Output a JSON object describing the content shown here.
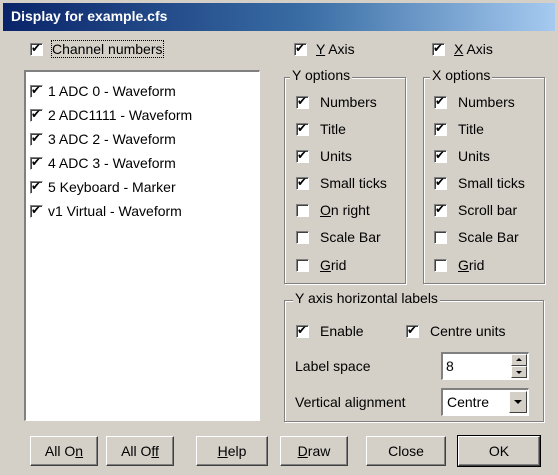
{
  "title": "Display for example.cfs",
  "channel_numbers": {
    "label": "Channel numbers",
    "checked": true
  },
  "channels": [
    {
      "label": "1 ADC 0 - Waveform",
      "checked": true
    },
    {
      "label": "2 ADC1111 - Waveform",
      "checked": true
    },
    {
      "label": "3 ADC 2 - Waveform",
      "checked": true
    },
    {
      "label": "4 ADC 3 - Waveform",
      "checked": true
    },
    {
      "label": "5 Keyboard - Marker",
      "checked": true
    },
    {
      "label": "v1 Virtual - Waveform",
      "checked": true
    }
  ],
  "y_axis": {
    "label_prefix": "",
    "label_key": "Y",
    "label_rest": " Axis",
    "checked": true,
    "options_title": "Y options",
    "options": [
      {
        "label": "Numbers",
        "checked": true
      },
      {
        "label": "Title",
        "checked": true
      },
      {
        "label": "Units",
        "checked": true
      },
      {
        "label": "Small ticks",
        "checked": true
      },
      {
        "label_key": "O",
        "label_rest": "n right",
        "checked": false
      },
      {
        "label": "Scale Bar",
        "checked": false
      },
      {
        "label_key": "G",
        "label_rest": "rid",
        "checked": false
      }
    ]
  },
  "x_axis": {
    "label_key": "X",
    "label_rest": " Axis",
    "checked": true,
    "options_title": "X options",
    "options": [
      {
        "label": "Numbers",
        "checked": true
      },
      {
        "label": "Title",
        "checked": true
      },
      {
        "label": "Units",
        "checked": true
      },
      {
        "label": "Small ticks",
        "checked": true
      },
      {
        "label": "Scroll bar",
        "checked": true
      },
      {
        "label": "Scale Bar",
        "checked": false
      },
      {
        "label_key": "G",
        "label_rest": "rid",
        "checked": false
      }
    ]
  },
  "horizontal_labels": {
    "title": "Y axis horizontal labels",
    "enable": {
      "label": "Enable",
      "checked": true
    },
    "centre_units": {
      "label": "Centre units",
      "checked": true
    },
    "label_space": {
      "label": "Label space",
      "value": "8"
    },
    "vertical_alignment": {
      "label": "Vertical alignment",
      "value": "Centre"
    }
  },
  "buttons": {
    "all_on": {
      "pre": "All O",
      "key": "n"
    },
    "all_off": {
      "pre": "All O",
      "key": "ff"
    },
    "help": {
      "key": "H",
      "rest": "elp"
    },
    "draw": {
      "key": "D",
      "rest": "raw"
    },
    "close": "Close",
    "ok": "OK"
  }
}
